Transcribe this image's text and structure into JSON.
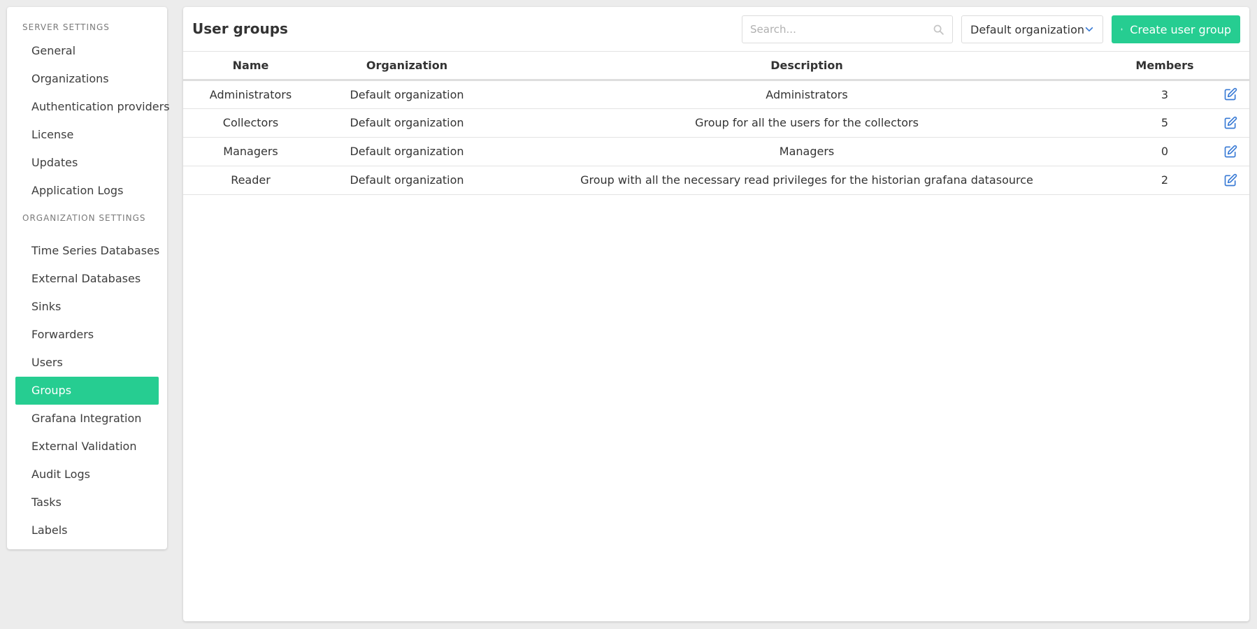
{
  "sidebar": {
    "server_section": "SERVER SETTINGS",
    "server_items": [
      {
        "label": "General"
      },
      {
        "label": "Organizations"
      },
      {
        "label": "Authentication providers"
      },
      {
        "label": "License"
      },
      {
        "label": "Updates"
      },
      {
        "label": "Application Logs"
      }
    ],
    "org_section": "ORGANIZATION SETTINGS",
    "org_items": [
      {
        "label": "Time Series Databases"
      },
      {
        "label": "External Databases"
      },
      {
        "label": "Sinks"
      },
      {
        "label": "Forwarders"
      },
      {
        "label": "Users"
      },
      {
        "label": "Groups",
        "active": true
      },
      {
        "label": "Grafana Integration"
      },
      {
        "label": "External Validation"
      },
      {
        "label": "Audit Logs"
      },
      {
        "label": "Tasks"
      },
      {
        "label": "Labels"
      }
    ]
  },
  "header": {
    "title": "User groups",
    "search_placeholder": "Search...",
    "org_select_value": "Default organization",
    "create_label": "Create user group"
  },
  "table": {
    "columns": [
      "Name",
      "Organization",
      "Description",
      "Members"
    ],
    "rows": [
      {
        "name": "Administrators",
        "organization": "Default organization",
        "description": "Administrators",
        "members": "3"
      },
      {
        "name": "Collectors",
        "organization": "Default organization",
        "description": "Group for all the users for the collectors",
        "members": "5"
      },
      {
        "name": "Managers",
        "organization": "Default organization",
        "description": "Managers",
        "members": "0"
      },
      {
        "name": "Reader",
        "organization": "Default organization",
        "description": "Group with all the necessary read privileges for the historian grafana datasource",
        "members": "2"
      }
    ]
  },
  "colors": {
    "accent": "#26cd91",
    "edit_icon": "#3a7bd5",
    "background": "#ececec"
  },
  "icons": {
    "search": "search-icon",
    "chevron": "chevron-down-icon",
    "plus": "plus-icon",
    "edit": "edit-icon"
  }
}
